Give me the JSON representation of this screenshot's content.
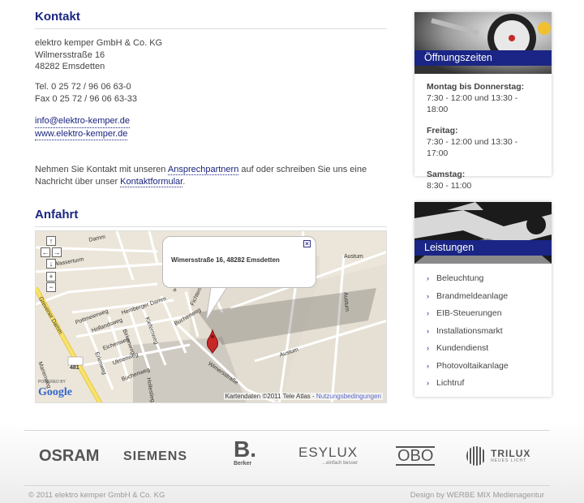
{
  "contact": {
    "title": "Kontakt",
    "company": "elektro kemper GmbH & Co. KG",
    "street": "Wilmersstraße 16",
    "city": "48282 Emsdetten",
    "tel": "Tel. 0 25 72 / 96 06 63-0",
    "fax": "Fax 0 25 72 / 96 06 63-33",
    "email": "info@elektro-kemper.de",
    "web": "www.elektro-kemper.de",
    "para_before": "Nehmen Sie Kontakt mit unseren ",
    "link_partners": "Ansprechpartnern",
    "para_middle": " auf oder schreiben Sie uns eine Nachricht über unser ",
    "link_form": "Kontaktformular",
    "para_after": "."
  },
  "directions": {
    "title": "Anfahrt",
    "map": {
      "bubble_text": "Wimersstraße 16, 48282 Emsdetten",
      "credit": "Kartendaten ©2011 Tele Atlas - ",
      "terms": "Nutzungsbedingungen",
      "powered_by": "POWERED BY",
      "google": "Google",
      "road_number": "481",
      "streets": [
        "Grevener Damm",
        "Hemberger Damm",
        "Pottmeierweg",
        "Hollandsweg",
        "Eichenweg",
        "Birkenweg",
        "Ulmenweg",
        "Kiefernweg",
        "Buchenweg",
        "Buchenweg",
        "Fichtenweg",
        "Wimersstraße",
        "Austum",
        "Austum",
        "Austum",
        "Hollestiege",
        "Marienweg",
        "Erlenweg",
        "Wasserturm",
        "Damm",
        "Hove"
      ]
    }
  },
  "sidebar": {
    "hours": {
      "title": "Öffnungszeiten",
      "entries": [
        {
          "day": "Montag bis Donnerstag:",
          "time": "7:30 - 12:00 und 13:30 - 18:00"
        },
        {
          "day": "Freitag:",
          "time": "7:30 - 12:00 und 13:30 - 17:00"
        },
        {
          "day": "Samstag:",
          "time": "8:30 - 11:00"
        }
      ]
    },
    "services": {
      "title": "Leistungen",
      "items": [
        "Beleuchtung",
        "Brandmeldeanlage",
        "EIB-Steuerungen",
        "Installationsmarkt",
        "Kundendienst",
        "Photovoltaikanlage",
        "Lichtruf"
      ]
    }
  },
  "partners": {
    "osram": "OSRAM",
    "siemens": "SIEMENS",
    "berker_mark": "B.",
    "berker_name": "Berker",
    "esylux": "ESYLUX",
    "esylux_tag": "...einfach besser",
    "obo": "OBO",
    "trilux": "TRILUX",
    "trilux_tag": "NEUES LICHT"
  },
  "footer": {
    "copyright": "© 2011 elektro kemper GmbH & Co. KG",
    "design": "Design by WERBE MIX Medienagentur"
  },
  "colors": {
    "accent": "#1a2585",
    "link": "#1a237e",
    "map_bg": "#ece6da",
    "road_yellow": "#f7e36b"
  }
}
